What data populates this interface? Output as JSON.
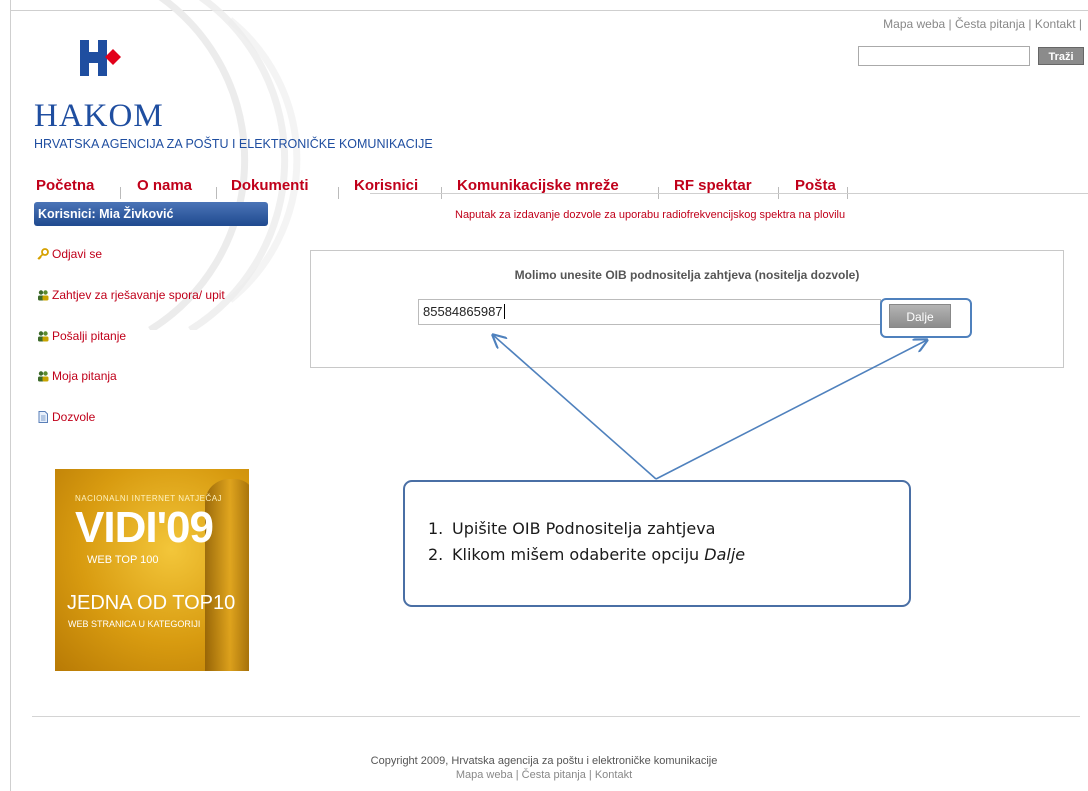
{
  "top_links": [
    "Mapa weba",
    "Česta pitanja",
    "Kontakt"
  ],
  "search": {
    "button_label": "Traži",
    "value": ""
  },
  "logo": {
    "name": "HAKOM",
    "subtitle": "HRVATSKA AGENCIJA ZA POŠTU I ELEKTRONIČKE KOMUNIKACIJE",
    "colors": {
      "blue": "#1f4ea0",
      "red": "#e2001a"
    }
  },
  "nav": [
    "Početna",
    "O nama",
    "Dokumenti",
    "Korisnici",
    "Komunikacijske mreže",
    "RF spektar",
    "Pošta"
  ],
  "user_bar": "Korisnici: Mia Živković",
  "sidebar": [
    {
      "label": "Odjavi se",
      "icon": "key-icon"
    },
    {
      "label": "Zahtjev za rješavanje spora/ upit",
      "icon": "users-icon"
    },
    {
      "label": "Pošalji pitanje",
      "icon": "users-icon"
    },
    {
      "label": "Moja pitanja",
      "icon": "users-icon"
    },
    {
      "label": "Dozvole",
      "icon": "document-icon"
    }
  ],
  "notice": "Naputak za izdavanje dozvole za uporabu radiofrekvencijskog spektra na plovilu",
  "form": {
    "title": "Molimo unesite OIB podnositelja zahtjeva (nositelja dozvole)",
    "oib_value": "85584865987",
    "next_button": "Dalje"
  },
  "callout": {
    "items": [
      {
        "num": "1.",
        "text": "Upišite OIB Podnositelja zahtjeva",
        "emph": ""
      },
      {
        "num": "2.",
        "text": "Klikom mišem odaberite opciju ",
        "emph": "Dalje"
      }
    ]
  },
  "banner": {
    "line1": "NACIONALNI INTERNET NATJEČAJ",
    "line2": "VIDI'09",
    "line3": "WEB TOP 100",
    "line4": "JEDNA OD TOP10",
    "line5": "WEB STRANICA U KATEGORIJI"
  },
  "footer": {
    "copyright": "Copyright 2009, Hrvatska agencija za poštu i elektroničke komunikacije",
    "links": "Mapa weba | Česta pitanja | Kontakt"
  },
  "colors": {
    "nav_red": "#c0001a",
    "callout_border": "#4a6fa5",
    "arrow": "#4f81bd"
  }
}
